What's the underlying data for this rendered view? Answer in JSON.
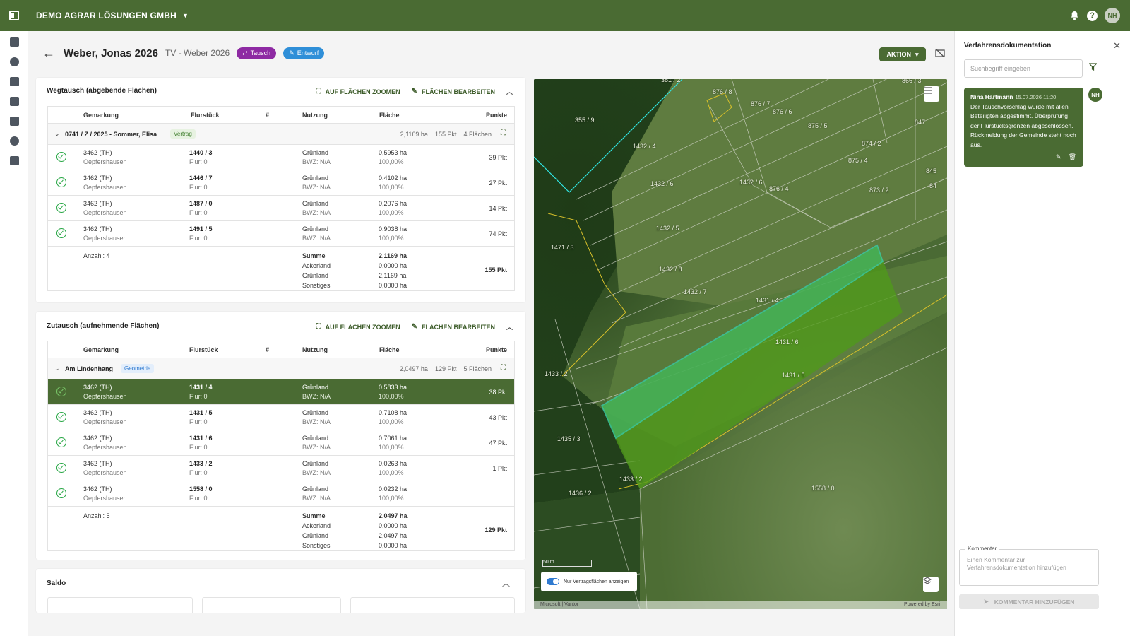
{
  "topbar": {
    "company": "DEMO AGRAR LÖSUNGEN GMBH",
    "avatar": "NH"
  },
  "header": {
    "title": "Weber, Jonas 2026",
    "subtitle": "TV - Weber 2026",
    "badges": {
      "tausch": "Tausch",
      "entwurf": "Entwurf"
    },
    "action_label": "AKTION"
  },
  "columns": {
    "gemarkung": "Gemarkung",
    "flurstueck": "Flurstück",
    "nr": "#",
    "nutzung": "Nutzung",
    "flaeche": "Fläche",
    "punkte": "Punkte"
  },
  "wegtausch": {
    "title": "Wegtausch (abgebende Flächen)",
    "zoom_label": "AUF FLÄCHEN ZOOMEN",
    "edit_label": "FLÄCHEN BEARBEITEN",
    "group": {
      "name": "0741 / Z / 2025 - Sommer, Elisa",
      "tag": "Vertrag",
      "area": "2,1169 ha",
      "points": "155 Pkt",
      "count": "4 Flächen"
    },
    "rows": [
      {
        "gem1": "3462 (TH)",
        "gem2": "Oepfershausen",
        "flst": "1440 / 3",
        "flur": "Flur: 0",
        "nutz": "Grünland",
        "bwz": "BWZ: N/A",
        "ha": "0,5953 ha",
        "pct": "100,00%",
        "pkt": "39 Pkt"
      },
      {
        "gem1": "3462 (TH)",
        "gem2": "Oepfershausen",
        "flst": "1446 / 7",
        "flur": "Flur: 0",
        "nutz": "Grünland",
        "bwz": "BWZ: N/A",
        "ha": "0,4102 ha",
        "pct": "100,00%",
        "pkt": "27 Pkt"
      },
      {
        "gem1": "3462 (TH)",
        "gem2": "Oepfershausen",
        "flst": "1487 / 0",
        "flur": "Flur: 0",
        "nutz": "Grünland",
        "bwz": "BWZ: N/A",
        "ha": "0,2076 ha",
        "pct": "100,00%",
        "pkt": "14 Pkt"
      },
      {
        "gem1": "3462 (TH)",
        "gem2": "Oepfershausen",
        "flst": "1491 / 5",
        "flur": "Flur: 0",
        "nutz": "Grünland",
        "bwz": "BWZ: N/A",
        "ha": "0,9038 ha",
        "pct": "100,00%",
        "pkt": "74 Pkt"
      }
    ],
    "summary": {
      "count": "Anzahl: 4",
      "labels": [
        "Summe",
        "Ackerland",
        "Grünland",
        "Sonstiges"
      ],
      "values": [
        "2,1169 ha",
        "0,0000 ha",
        "2,1169 ha",
        "0,0000 ha"
      ],
      "points": "155 Pkt"
    }
  },
  "zutausch": {
    "title": "Zutausch (aufnehmende Flächen)",
    "zoom_label": "AUF FLÄCHEN ZOOMEN",
    "edit_label": "FLÄCHEN BEARBEITEN",
    "group": {
      "name": "Am Lindenhang",
      "tag": "Geometrie",
      "area": "2,0497 ha",
      "points": "129 Pkt",
      "count": "5 Flächen"
    },
    "rows": [
      {
        "gem1": "3462 (TH)",
        "gem2": "Oepfershausen",
        "flst": "1431 / 4",
        "flur": "Flur: 0",
        "nutz": "Grünland",
        "bwz": "BWZ: N/A",
        "ha": "0,5833 ha",
        "pct": "100,00%",
        "pkt": "38 Pkt"
      },
      {
        "gem1": "3462 (TH)",
        "gem2": "Oepfershausen",
        "flst": "1431 / 5",
        "flur": "Flur: 0",
        "nutz": "Grünland",
        "bwz": "BWZ: N/A",
        "ha": "0,7108 ha",
        "pct": "100,00%",
        "pkt": "43 Pkt"
      },
      {
        "gem1": "3462 (TH)",
        "gem2": "Oepfershausen",
        "flst": "1431 / 6",
        "flur": "Flur: 0",
        "nutz": "Grünland",
        "bwz": "BWZ: N/A",
        "ha": "0,7061 ha",
        "pct": "100,00%",
        "pkt": "47 Pkt"
      },
      {
        "gem1": "3462 (TH)",
        "gem2": "Oepfershausen",
        "flst": "1433 / 2",
        "flur": "Flur: 0",
        "nutz": "Grünland",
        "bwz": "BWZ: N/A",
        "ha": "0,0263 ha",
        "pct": "100,00%",
        "pkt": "1 Pkt"
      },
      {
        "gem1": "3462 (TH)",
        "gem2": "Oepfershausen",
        "flst": "1558 / 0",
        "flur": "Flur: 0",
        "nutz": "Grünland",
        "bwz": "BWZ: N/A",
        "ha": "0,0232 ha",
        "pct": "100,00%",
        "pkt": ""
      }
    ],
    "summary": {
      "count": "Anzahl: 5",
      "labels": [
        "Summe",
        "Ackerland",
        "Grünland",
        "Sonstiges"
      ],
      "values": [
        "2,0497 ha",
        "0,0000 ha",
        "2,0497 ha",
        "0,0000 ha"
      ],
      "points": "129 Pkt"
    }
  },
  "saldo": {
    "title": "Saldo"
  },
  "map": {
    "parcel_labels": [
      "355 / 9",
      "1432 / 4",
      "876 / 7",
      "876 / 6",
      "875 / 5",
      "876 / 8",
      "874 / 2",
      "847",
      "875 / 4",
      "84",
      "845",
      "1432 / 6",
      "1432 / 6",
      "876 / 4",
      "873 / 2",
      "1432 / 5",
      "1471 / 3",
      "1432 / 8",
      "1432 / 7",
      "1431 / 4",
      "1431 / 6",
      "1433 / 2",
      "1431 / 5",
      "1435 / 3",
      "1433 / 2",
      "1436 / 2",
      "1558 / 0",
      "866 / 3",
      "361 / 2"
    ],
    "scale": "50 m",
    "toggle_label": "Nur Vertragsflächen anzeigen",
    "attribution_left": "Microsoft | Vantor",
    "attribution_right": "Powered by Esri",
    "colors": {
      "selected_fill": "#4f9a1a",
      "selected_stroke": "#2fe3e0",
      "boundary": "#cfd3c6",
      "contract": "#d8c02a"
    }
  },
  "doc": {
    "title": "Verfahrensdokumentation",
    "search_placeholder": "Suchbegriff eingeben",
    "comment": {
      "author": "Nina Hartmann",
      "date": "15.07.2026 11:20",
      "text": "Der Tauschvorschlag wurde mit allen Beteiligten abgestimmt. Überprüfung der Flurstücksgrenzen abgeschlossen. Rückmeldung der Gemeinde steht noch aus.",
      "avatar": "NH"
    },
    "comment_label": "Kommentar",
    "comment_placeholder": "Einen Kommentar zur Verfahrensdokumentation hinzufügen",
    "add_button": "KOMMENTAR HINZUFÜGEN"
  }
}
